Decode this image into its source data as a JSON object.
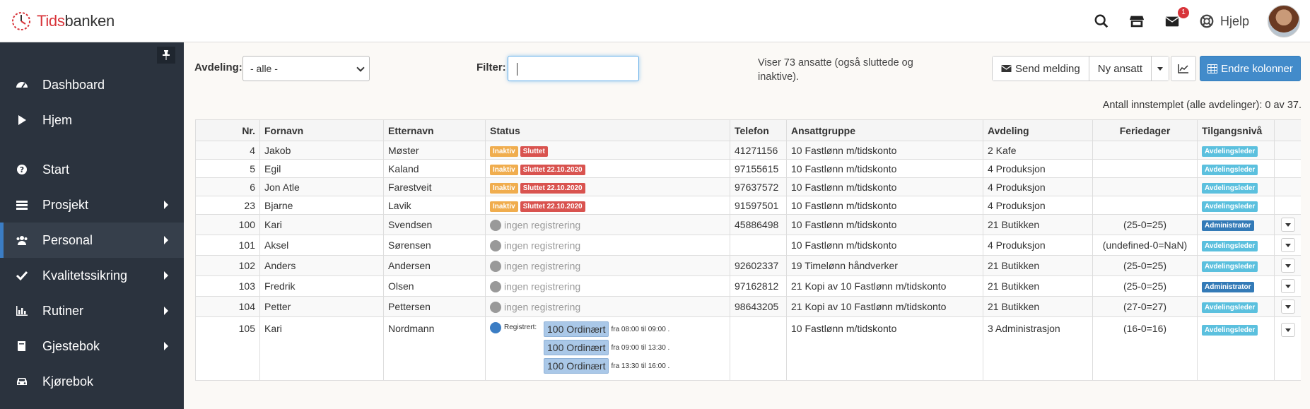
{
  "header": {
    "logo_prefix": "Tids",
    "logo_suffix": "banken",
    "mail_count": "1",
    "help_label": "Hjelp",
    "icons": [
      "search-icon",
      "store-icon",
      "envelope-icon",
      "lifebuoy-icon"
    ]
  },
  "sidebar": {
    "items": [
      {
        "label": "Dashboard",
        "icon": "dashboard-icon"
      },
      {
        "label": "Hjem",
        "icon": "play-icon"
      },
      {
        "label": "Start",
        "icon": "question-circle-icon"
      },
      {
        "label": "Prosjekt",
        "icon": "list-icon"
      },
      {
        "label": "Personal",
        "icon": "users-icon"
      },
      {
        "label": "Kvalitetssikring",
        "icon": "check-icon"
      },
      {
        "label": "Rutiner",
        "icon": "bar-chart-icon"
      },
      {
        "label": "Gjestebok",
        "icon": "book-icon"
      },
      {
        "label": "Kjørebok",
        "icon": "car-icon"
      }
    ]
  },
  "toolbar": {
    "avdeling_label": "Avdeling:",
    "avdeling_value": "- alle -",
    "filter_label": "Filter:",
    "showing_text": "Viser 73 ansatte (også sluttede og inaktive).",
    "send_message": "Send melding",
    "new_employee": "Ny ansatt",
    "change_columns": "Endre kolonner",
    "count_text": "Antall innstemplet (alle avdelinger): 0 av 37."
  },
  "table": {
    "columns": [
      "Nr.",
      "Fornavn",
      "Etternavn",
      "Status",
      "Telefon",
      "Ansattgruppe",
      "Avdeling",
      "Feriedager",
      "Tilgangsnivå",
      ""
    ],
    "status_inactive": "Inaktiv",
    "status_quit": "Sluttet",
    "status_quit_date": "Sluttet 22.10.2020",
    "no_registration": "ingen registrering",
    "registered_label": "Registrert:",
    "rows": [
      {
        "nr": "4",
        "first": "Jakob",
        "last": "Møster",
        "phone": "41271156",
        "group": "10 Fastlønn m/tidskonto",
        "dept": "2 Kafe",
        "vacation": "",
        "access": "Avdelingsleder"
      },
      {
        "nr": "5",
        "first": "Egil",
        "last": "Kaland",
        "phone": "97155615",
        "group": "10 Fastlønn m/tidskonto",
        "dept": "4 Produksjon",
        "vacation": "",
        "access": "Avdelingsleder"
      },
      {
        "nr": "6",
        "first": "Jon Atle",
        "last": "Farestveit",
        "phone": "97637572",
        "group": "10 Fastlønn m/tidskonto",
        "dept": "4 Produksjon",
        "vacation": "",
        "access": "Avdelingsleder"
      },
      {
        "nr": "23",
        "first": "Bjarne",
        "last": "Lavik",
        "phone": "91597501",
        "group": "10 Fastlønn m/tidskonto",
        "dept": "4 Produksjon",
        "vacation": "",
        "access": "Avdelingsleder"
      },
      {
        "nr": "100",
        "first": "Kari",
        "last": "Svendsen",
        "phone": "45886498",
        "group": "10 Fastlønn m/tidskonto",
        "dept": "21 Butikken",
        "vacation": "(25-0=25)",
        "access": "Administrator"
      },
      {
        "nr": "101",
        "first": "Aksel",
        "last": "Sørensen",
        "phone": "",
        "group": "10 Fastlønn m/tidskonto",
        "dept": "4 Produksjon",
        "vacation": "(undefined-0=NaN)",
        "access": "Avdelingsleder"
      },
      {
        "nr": "102",
        "first": "Anders",
        "last": "Andersen",
        "phone": "92602337",
        "group": "19 Timelønn håndverker",
        "dept": "21 Butikken",
        "vacation": "(25-0=25)",
        "access": "Avdelingsleder"
      },
      {
        "nr": "103",
        "first": "Fredrik",
        "last": "Olsen",
        "phone": "97162812",
        "group": "21 Kopi av 10 Fastlønn m/tidskonto",
        "dept": "21 Butikken",
        "vacation": "(25-0=25)",
        "access": "Administrator"
      },
      {
        "nr": "104",
        "first": "Petter",
        "last": "Pettersen",
        "phone": "98643205",
        "group": "21 Kopi av 10 Fastlønn m/tidskonto",
        "dept": "21 Butikken",
        "vacation": "(27-0=27)",
        "access": "Avdelingsleder"
      },
      {
        "nr": "105",
        "first": "Kari",
        "last": "Nordmann",
        "phone": "",
        "group": "10 Fastlønn m/tidskonto",
        "dept": "3 Administrasjon",
        "vacation": "(16-0=16)",
        "access": "Avdelingsleder"
      }
    ],
    "registrations": [
      {
        "code": "100 Ordinært",
        "time": "fra 08:00 til 09:00 ."
      },
      {
        "code": "100 Ordinært",
        "time": "fra 09:00 til 13:30 ."
      },
      {
        "code": "100 Ordinært",
        "time": "fra 13:30 til 16:00 ."
      }
    ]
  },
  "colors": {
    "brand_red": "#d8343a",
    "sidebar_bg": "#2b333e",
    "primary_blue": "#428bca",
    "inactive_orange": "#f0ad4e",
    "quit_red": "#d9534f",
    "access_teal": "#5bc0de",
    "admin_blue": "#337ab7"
  }
}
